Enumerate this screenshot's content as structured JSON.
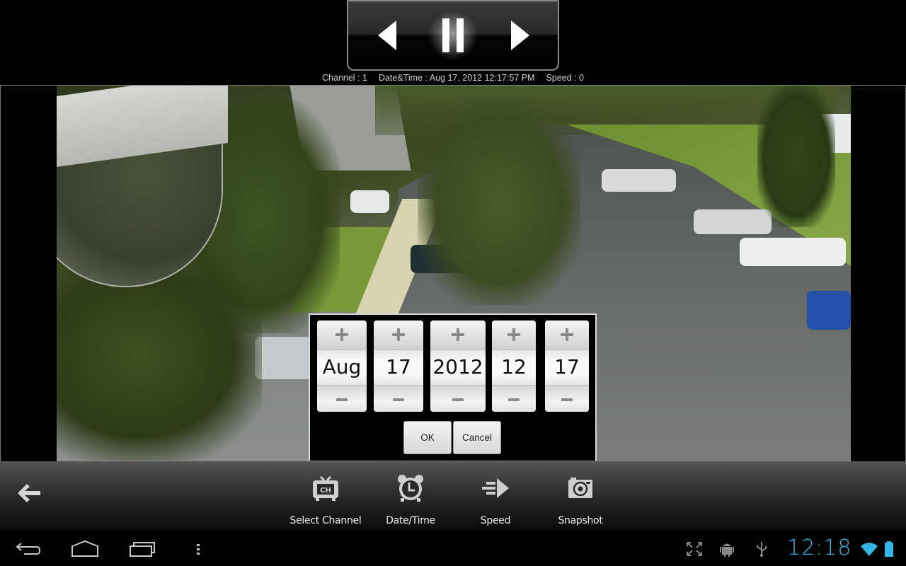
{
  "playback": {
    "prev_icon": "rewind-triangle-icon",
    "pause_icon": "pause-icon",
    "next_icon": "forward-triangle-icon",
    "state": "playing"
  },
  "status": {
    "channel": "Channel : 1",
    "datetime": "Date&Time : Aug 17, 2012 12:17:57 PM",
    "speed": "Speed : 0"
  },
  "video": {
    "description": "Security camera feed of a parking lot with trees and parked cars"
  },
  "datetime_dialog": {
    "pickers": [
      {
        "name": "month",
        "value": "Aug"
      },
      {
        "name": "day",
        "value": "17"
      },
      {
        "name": "year",
        "value": "2012"
      },
      {
        "name": "hour",
        "value": "12"
      },
      {
        "name": "minute",
        "value": "17"
      }
    ],
    "ok_label": "OK",
    "cancel_label": "Cancel"
  },
  "toolbar": {
    "back_icon": "back-arrow-icon",
    "items": [
      {
        "label": "Select Channel",
        "icon": "tv-channel-icon"
      },
      {
        "label": "Date/Time",
        "icon": "alarm-clock-icon"
      },
      {
        "label": "Speed",
        "icon": "speed-arrow-icon"
      },
      {
        "label": "Snapshot",
        "icon": "camera-icon"
      }
    ]
  },
  "system_bar": {
    "nav": [
      "back",
      "home",
      "recent-apps",
      "menu"
    ],
    "status_icons": [
      "screen-compat",
      "android-debug",
      "usb",
      "wifi",
      "battery"
    ],
    "clock": "12:18",
    "accent_color": "#33b5e5"
  }
}
